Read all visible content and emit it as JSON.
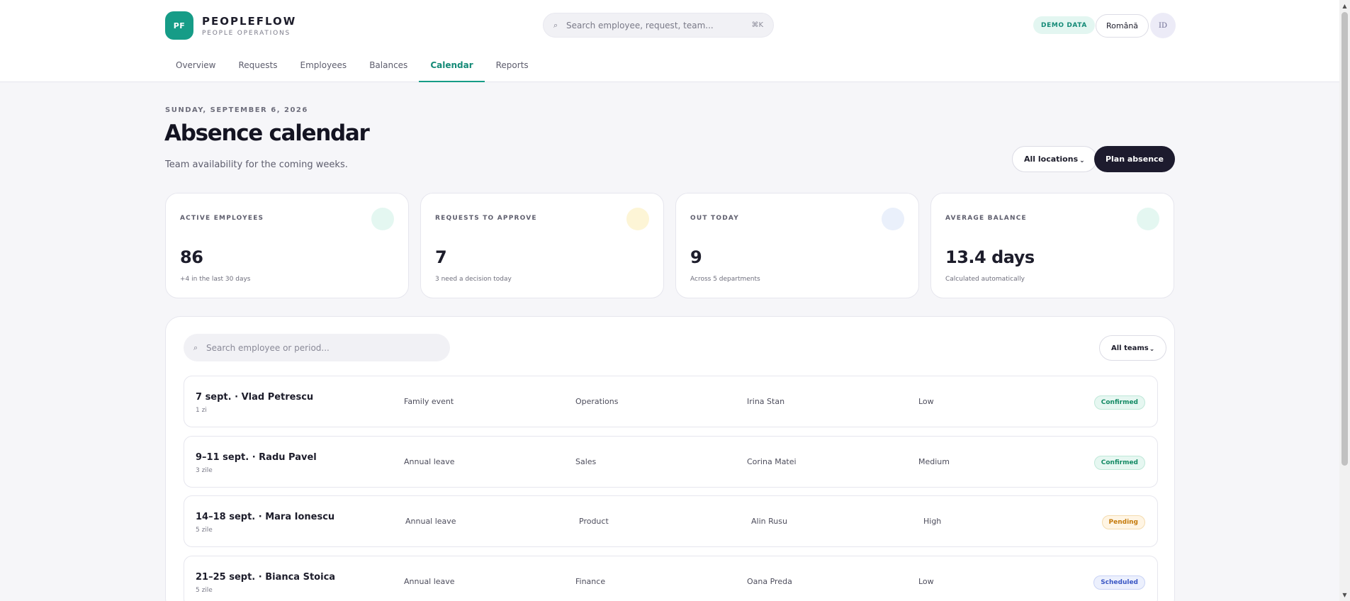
{
  "brand": {
    "logo": "PF",
    "name": "PEOPLEFLOW",
    "subtitle": "PEOPLE OPERATIONS"
  },
  "global_search": {
    "placeholder": "Search employee, request, team...",
    "icon": "search-icon",
    "shortcut": "⌘K"
  },
  "header": {
    "demo_badge": "DEMO DATA",
    "language": "Română",
    "avatar_initials": "ID"
  },
  "nav": {
    "tabs": [
      {
        "label": "Overview",
        "active": false
      },
      {
        "label": "Requests",
        "active": false
      },
      {
        "label": "Employees",
        "active": false
      },
      {
        "label": "Balances",
        "active": false
      },
      {
        "label": "Calendar",
        "active": true
      },
      {
        "label": "Reports",
        "active": false
      }
    ]
  },
  "page": {
    "date": "SUNDAY, SEPTEMBER 6, 2026",
    "title": "Absence calendar",
    "subtitle": "Team availability for the coming weeks.",
    "locations_button": "All locations",
    "plan_button": "Plan absence"
  },
  "stats": [
    {
      "label": "ACTIVE EMPLOYEES",
      "value": "86",
      "note": "+4 in the last 30 days",
      "dot_color": "#e4f7f1"
    },
    {
      "label": "REQUESTS TO APPROVE",
      "value": "7",
      "note": "3 need a decision today",
      "dot_color": "#fdf5d6"
    },
    {
      "label": "OUT TODAY",
      "value": "9",
      "note": "Across 5 departments",
      "dot_color": "#eaf0fb"
    },
    {
      "label": "AVERAGE BALANCE",
      "value": "13.4 days",
      "note": "Calculated automatically",
      "dot_color": "#e4f7f1"
    }
  ],
  "panel": {
    "search_placeholder": "Search employee or period...",
    "teams_button": "All teams",
    "rows": [
      {
        "title": "7 sept. · Vlad Petrescu",
        "duration": "1 zi",
        "type": "Family event",
        "department": "Operations",
        "approver": "Irina Stan",
        "impact": "Low",
        "status": "Confirmed",
        "status_kind": "confirmed"
      },
      {
        "title": "9–11 sept. · Radu Pavel",
        "duration": "3 zile",
        "type": "Annual leave",
        "department": "Sales",
        "approver": "Corina Matei",
        "impact": "Medium",
        "status": "Confirmed",
        "status_kind": "confirmed"
      },
      {
        "title": "14–18 sept. · Mara Ionescu",
        "duration": "5 zile",
        "type": "Annual leave",
        "department": "Product",
        "approver": "Alin Rusu",
        "impact": "High",
        "status": "Pending",
        "status_kind": "pending"
      },
      {
        "title": "21–25 sept. · Bianca Stoica",
        "duration": "5 zile",
        "type": "Annual leave",
        "department": "Finance",
        "approver": "Oana Preda",
        "impact": "Low",
        "status": "Scheduled",
        "status_kind": "scheduled"
      }
    ]
  },
  "colors": {
    "accent": "#169c87",
    "primary_button": "#1d1b2e",
    "background": "#f6f6f9"
  }
}
